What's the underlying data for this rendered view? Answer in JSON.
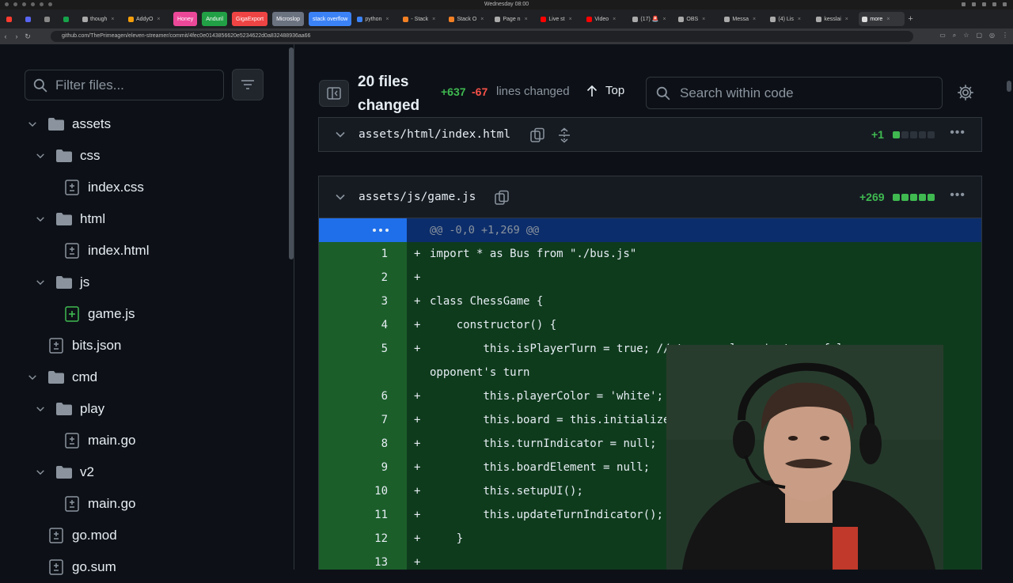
{
  "menubar": {
    "clock": "Wednesday 08:00"
  },
  "browser": {
    "tabs": [
      {
        "label": "",
        "fav": "#ff3b30"
      },
      {
        "label": "",
        "fav": "#5865f2"
      },
      {
        "label": "",
        "fav": "#888"
      },
      {
        "label": "",
        "fav": "#16a34a"
      },
      {
        "label": "though",
        "fav": "#aaa"
      },
      {
        "label": "AddyO",
        "fav": "#f59e0b"
      },
      {
        "label": "Honey",
        "pill": "#ec4899"
      },
      {
        "label": "Anduril",
        "pill": "#22a046"
      },
      {
        "label": "GigaExport",
        "pill": "#ef4444"
      },
      {
        "label": "Microslop",
        "pill": "#6b7280"
      },
      {
        "label": "stack overflow",
        "pill": "#3b82f6"
      },
      {
        "label": "python",
        "fav": "#3b82f6"
      },
      {
        "label": "- Stack",
        "fav": "#f48024"
      },
      {
        "label": "Stack O",
        "fav": "#f48024"
      },
      {
        "label": "Page n",
        "fav": "#aaa"
      },
      {
        "label": "Live st",
        "fav": "#ff0000"
      },
      {
        "label": "Video",
        "fav": "#ff0000"
      },
      {
        "label": "(17) 🚨",
        "fav": "#aaa"
      },
      {
        "label": "OBS",
        "fav": "#aaa"
      },
      {
        "label": "Messa",
        "fav": "#aaa"
      },
      {
        "label": "(4) Lis",
        "fav": "#aaa"
      },
      {
        "label": "kesslai",
        "fav": "#aaa"
      },
      {
        "label": "more",
        "fav": "#ddd",
        "active": true
      }
    ],
    "url": "github.com/ThePrimeagen/eleven-streamer/commit/4fec0e0143856620e5234622d0a832488936aa66"
  },
  "sidebar": {
    "filter_placeholder": "Filter files...",
    "tree": [
      {
        "type": "folder",
        "label": "assets",
        "depth": 0
      },
      {
        "type": "folder",
        "label": "css",
        "depth": 1
      },
      {
        "type": "file",
        "label": "index.css",
        "depth": 2,
        "status": "modified"
      },
      {
        "type": "folder",
        "label": "html",
        "depth": 1
      },
      {
        "type": "file",
        "label": "index.html",
        "depth": 2,
        "status": "modified"
      },
      {
        "type": "folder",
        "label": "js",
        "depth": 1
      },
      {
        "type": "file",
        "label": "game.js",
        "depth": 2,
        "status": "added"
      },
      {
        "type": "file",
        "label": "bits.json",
        "depth": 1,
        "status": "modified"
      },
      {
        "type": "folder",
        "label": "cmd",
        "depth": 0
      },
      {
        "type": "folder",
        "label": "play",
        "depth": 1
      },
      {
        "type": "file",
        "label": "main.go",
        "depth": 2,
        "status": "modified"
      },
      {
        "type": "folder",
        "label": "v2",
        "depth": 1
      },
      {
        "type": "file",
        "label": "main.go",
        "depth": 2,
        "status": "modified"
      },
      {
        "type": "file",
        "label": "go.mod",
        "depth": 1,
        "status": "modified"
      },
      {
        "type": "file",
        "label": "go.sum",
        "depth": 1,
        "status": "modified"
      }
    ]
  },
  "summary": {
    "files_changed": "20 files changed",
    "additions": "+637",
    "deletions": "-67",
    "lines_changed": "lines changed",
    "top_label": "Top",
    "search_placeholder": "Search within code"
  },
  "files": [
    {
      "name": "assets/html/index.html",
      "stat": "+1",
      "bars": [
        "#3fb950",
        "#2d333b",
        "#2d333b",
        "#2d333b",
        "#2d333b"
      ]
    },
    {
      "name": "assets/js/game.js",
      "stat": "+269",
      "bars": [
        "#3fb950",
        "#3fb950",
        "#3fb950",
        "#3fb950",
        "#3fb950"
      ]
    }
  ],
  "diff": {
    "hunk": "@@ -0,0 +1,269 @@",
    "lines": [
      {
        "num": "1",
        "code": "import * as Bus from \"./bus.js\""
      },
      {
        "num": "2",
        "code": ""
      },
      {
        "num": "3",
        "code": "class ChessGame {"
      },
      {
        "num": "4",
        "code": "    constructor() {"
      },
      {
        "num": "5",
        "code": "        this.isPlayerTurn = true; // true = player's turn, false = opponent's turn",
        "wrap": true
      },
      {
        "num": "6",
        "code": "        this.playerColor = 'white'; // 'whi"
      },
      {
        "num": "7",
        "code": "        this.board = this.initializeBoard();"
      },
      {
        "num": "8",
        "code": "        this.turnIndicator = null;"
      },
      {
        "num": "9",
        "code": "        this.boardElement = null;"
      },
      {
        "num": "10",
        "code": "        this.setupUI();"
      },
      {
        "num": "11",
        "code": "        this.updateTurnIndicator();"
      },
      {
        "num": "12",
        "code": "    }"
      },
      {
        "num": "13",
        "code": ""
      }
    ]
  }
}
